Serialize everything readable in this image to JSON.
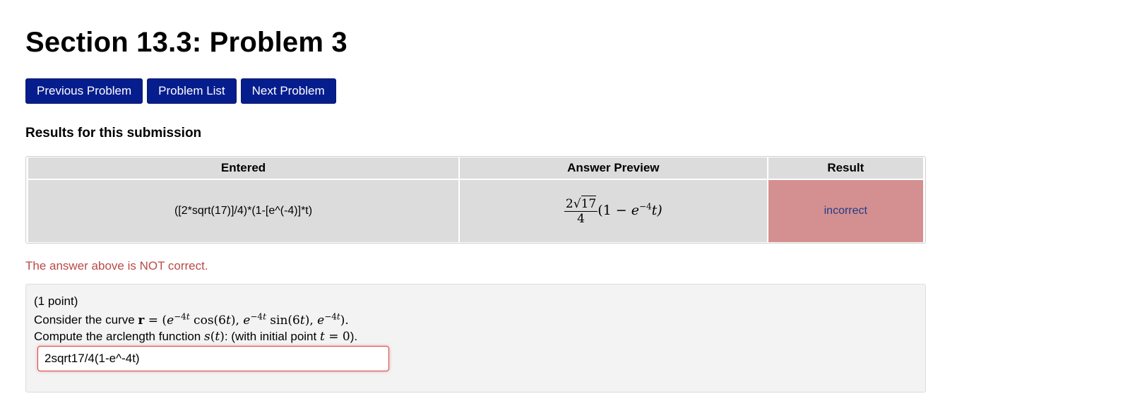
{
  "page": {
    "title": "Section 13.3: Problem 3"
  },
  "nav": {
    "previous_label": "Previous Problem",
    "list_label": "Problem List",
    "next_label": "Next Problem"
  },
  "results": {
    "heading": "Results for this submission",
    "columns": [
      "Entered",
      "Answer Preview",
      "Result"
    ],
    "row": {
      "entered": "([2*sqrt(17)]/4)*(1-[e^(-4)]*t)",
      "preview": {
        "numerator_coeff": "2",
        "radicand": "17",
        "denominator": "4",
        "factor_open": "(1 − ",
        "base": "e",
        "exponent": "−4",
        "factor_close": "t)"
      },
      "result": "incorrect"
    }
  },
  "feedback": "The answer above is NOT correct.",
  "problem": {
    "points": "(1 point)",
    "line1_prefix": "Consider the curve ",
    "line1_math": "r = (e",
    "line2_prefix": "Compute the arclength function ",
    "line2_mid": ": (with initial point ",
    "line2_suffix": ").",
    "answer_value": "2sqrt17/4(1-e^-4t)"
  },
  "colors": {
    "button_bg": "#061d8e",
    "result_incorrect_bg": "#d49090",
    "feedback_text": "#b94a48",
    "input_error_border": "#d64545"
  }
}
